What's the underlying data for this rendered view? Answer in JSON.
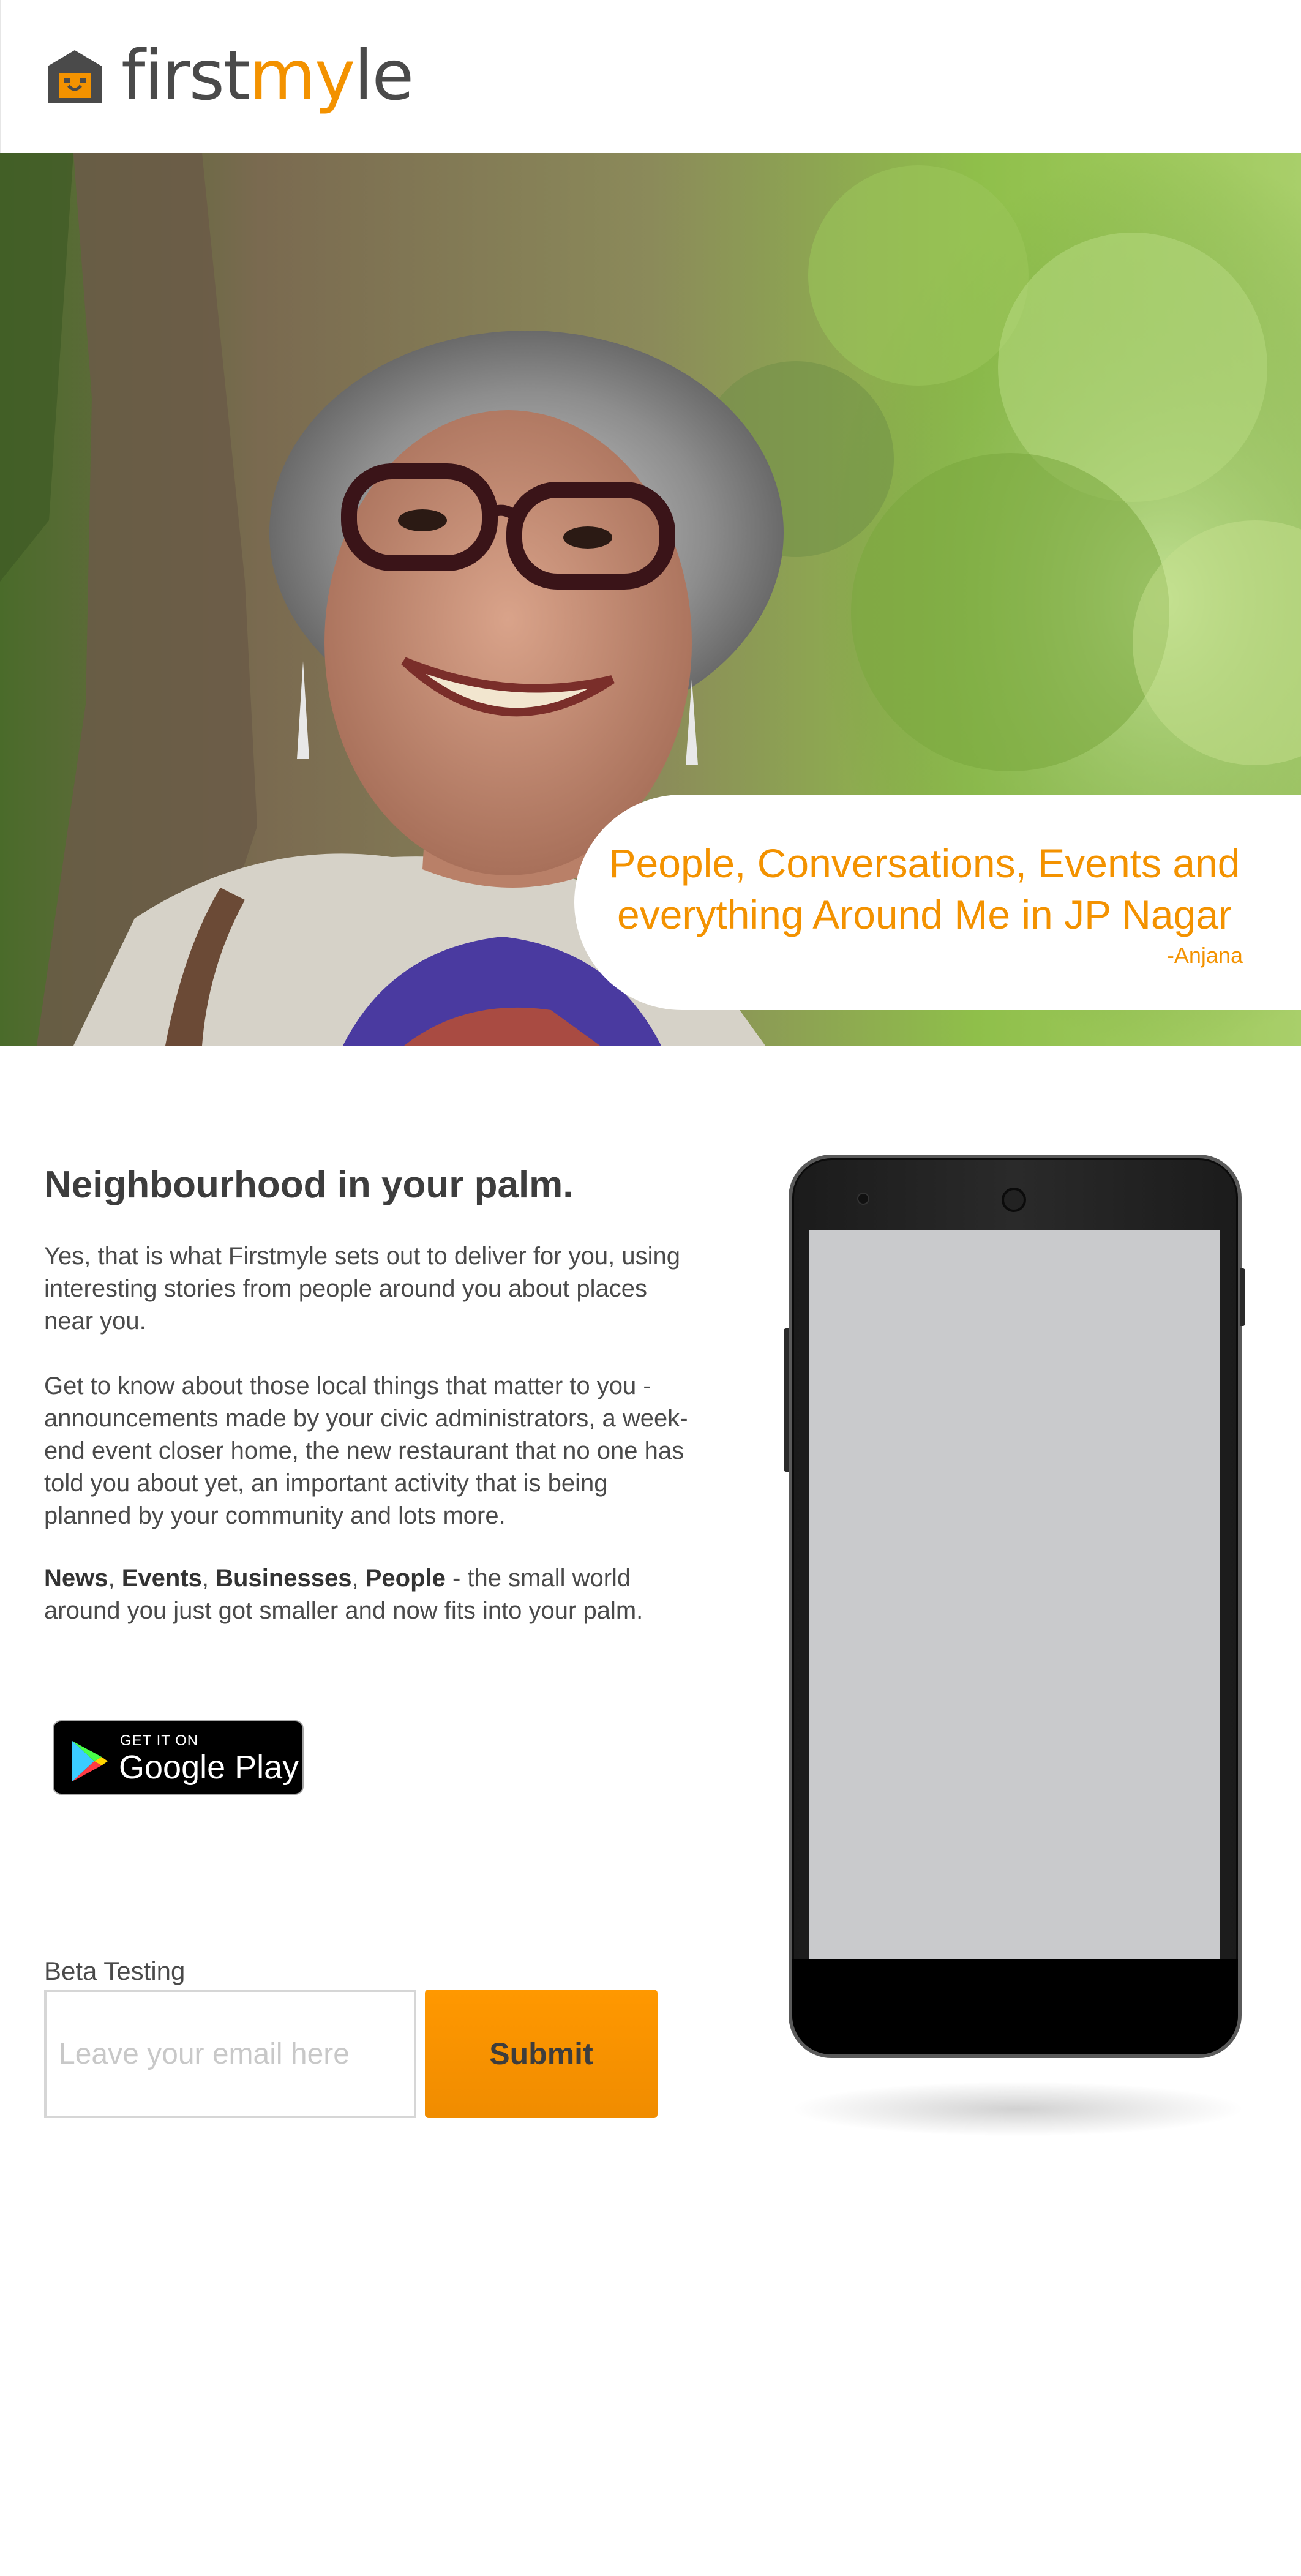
{
  "brand": {
    "name_prefix": "first",
    "name_accent": "my",
    "name_suffix": "le",
    "accent_color": "#f39200",
    "icon": "house-logo-icon"
  },
  "hero": {
    "quote": "People, Conversations, Events and everything Around Me in JP Nagar",
    "author": "-Anjana"
  },
  "main": {
    "heading": "Neighbourhood in your palm.",
    "paragraph1": "Yes, that is what Firstmyle sets out to deliver for you, using interesting stories from people around you about places near you.",
    "paragraph2": "Get to know about those local things that matter to you - announcements made by your civic administrators, a week-end event closer home, the new restaurant that no one has told you about yet, an important activity that is being planned by your community and lots more.",
    "para3_bold_1": "News",
    "para3_sep_1": ", ",
    "para3_bold_2": "Events",
    "para3_sep_2": ", ",
    "para3_bold_3": "Businesses",
    "para3_sep_3": ", ",
    "para3_bold_4": "People",
    "para3_rest": " - the small world around you just got smaller and now fits into your palm."
  },
  "store_badge": {
    "small_text": "GET IT ON",
    "big_text": "Google Play",
    "icon": "google-play-icon"
  },
  "beta": {
    "label": "Beta Testing",
    "email_placeholder": "Leave your email here",
    "email_value": "",
    "submit_label": "Submit"
  }
}
